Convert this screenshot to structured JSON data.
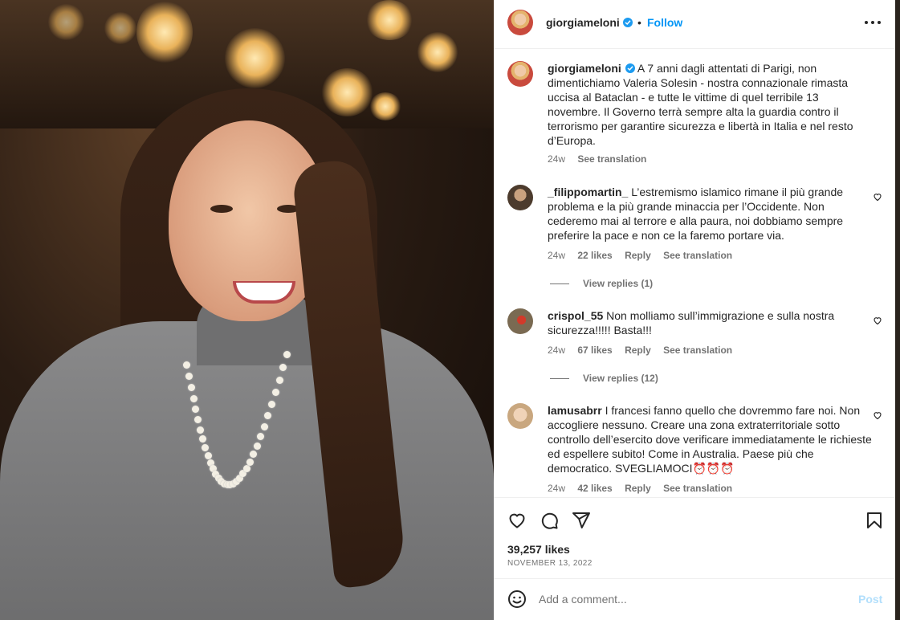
{
  "post": {
    "image_alt": "",
    "author": "giorgiameloni",
    "follow_label": "Follow",
    "caption": "A 7 anni dagli attentati di Parigi, non dimentichiamo Valeria Solesin - nostra connazionale rimasta uccisa al Bataclan - e tutte le vittime di quel terribile 13 novembre. Il Governo terrà sempre alta la guardia contro il terrorismo per garantire sicurezza e libertà in Italia e nel resto d’Europa.",
    "caption_time": "24w",
    "see_translation": "See translation",
    "likes": "39,257 likes",
    "date": "NOVEMBER 13, 2022"
  },
  "comments": [
    {
      "user": "_filippomartin_",
      "text": "L’estremismo islamico rimane il più grande problema e la più grande minaccia per l’Occidente. Non cederemo mai al terrore e alla paura, noi dobbiamo sempre preferire la pace e non ce la faremo portare via.",
      "time": "24w",
      "likes": "22 likes",
      "reply": "Reply",
      "translate": "See translation",
      "view_replies": "View replies (1)"
    },
    {
      "user": "crispol_55",
      "text": "Non molliamo sull’immigrazione e sulla nostra sicurezza!!!!! Basta!!!",
      "time": "24w",
      "likes": "67 likes",
      "reply": "Reply",
      "translate": "See translation",
      "view_replies": "View replies (12)"
    },
    {
      "user": "lamusabrr",
      "text": "I francesi fanno quello che dovremmo fare noi. Non accogliere nessuno. Creare una zona extraterritoriale sotto controllo dell’esercito dove verificare immediatamente le richieste ed espellere subito! Come in Australia. Paese più che democratico. SVEGLIAMOCI⏰⏰⏰",
      "time": "24w",
      "likes": "42 likes",
      "reply": "Reply",
      "translate": "See translation"
    }
  ],
  "composer": {
    "placeholder": "Add a comment...",
    "post_label": "Post"
  },
  "icons": {
    "more": "more-options-icon",
    "verified": "verified-badge-icon",
    "like": "heart-icon",
    "comment": "comment-icon",
    "share": "send-icon",
    "save": "bookmark-icon",
    "emoji": "emoji-icon"
  },
  "colors": {
    "link_blue": "#0095f6",
    "post_disabled": "#b2dffc",
    "verified": "#1d9bf0",
    "secondary_text": "#737373"
  }
}
